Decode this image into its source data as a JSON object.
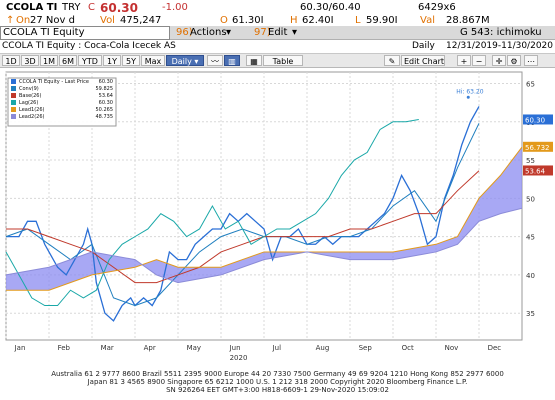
{
  "ticker": {
    "symbol": "CCOLA TI",
    "currency": "TRY",
    "change_flag": "C",
    "last": "60.30",
    "change": "-1.00",
    "bid_ask": "60.30/60.40",
    "size": "6429x6",
    "date_prefix": "On",
    "date": "27 Nov d",
    "vol_label": "Vol",
    "vol": "475,247",
    "open_label": "O",
    "open": "61.30I",
    "high_label": "H",
    "high": "62.40I",
    "low_label": "L",
    "low": "59.90I",
    "val_label": "Val",
    "val": "28.867M"
  },
  "menubar": {
    "actions_num": "96)",
    "actions": "Actions",
    "edit_num": "97)",
    "edit": "Edit",
    "page": "G 543: ichimoku"
  },
  "window": {
    "security": "CCOLA TI Equity",
    "name": "CCOLA TI Equity : Coca-Cola Icecek AS",
    "frequency": "Daily",
    "range": "12/31/2019-11/30/2020"
  },
  "toolbar": {
    "periods": [
      "1D",
      "3D",
      "1M",
      "6M",
      "YTD",
      "1Y",
      "5Y",
      "Max"
    ],
    "freq": "Daily",
    "table": "Table",
    "edit_chart": "Edit Chart"
  },
  "legend": [
    {
      "label": "CCOLA TI Equity - Last Price",
      "value": "60.30",
      "color": "#2a6fd6"
    },
    {
      "label": "Conv(9)",
      "value": "59.825",
      "color": "#1f7fbf"
    },
    {
      "label": "Base(26)",
      "value": "53.64",
      "color": "#c0392b"
    },
    {
      "label": "Lag(26)",
      "value": "60.30",
      "color": "#1aa8a8"
    },
    {
      "label": "Lead1(26)",
      "value": "50.265",
      "color": "#e39a1b"
    },
    {
      "label": "Lead2(26)",
      "value": "48.735",
      "color": "#8b8bd8"
    }
  ],
  "annotation": "Hi: 63.20",
  "price_tags": [
    {
      "value": "60.30",
      "color": "#2a6fd6"
    },
    {
      "value": "56.732",
      "color": "#e39a1b"
    },
    {
      "value": "53.64",
      "color": "#c0392b"
    }
  ],
  "footer": {
    "line1": "Australia 61 2 9777 8600 Brazil 5511 2395 9000 Europe 44 20 7330 7500 Germany 49 69 9204 1210 Hong Kong 852 2977 6000",
    "line2": "Japan 81 3 4565 8900        Singapore 65 6212 1000       U.S. 1 212 318 2000        Copyright 2020 Bloomberg Finance L.P.",
    "line3": "SN 926264 EET  GMT+3:00 H818-6609-1 29-Nov-2020 15:09:02"
  },
  "chart_data": {
    "type": "line",
    "x_labels": [
      "Jan",
      "Feb",
      "Mar",
      "Apr",
      "May",
      "Jun",
      "Jul",
      "Aug",
      "Sep",
      "Oct",
      "Nov",
      "Dec"
    ],
    "year_label": "2020",
    "y_ticks": [
      35,
      40,
      45,
      50,
      55,
      60,
      65
    ],
    "ylim": [
      31.5,
      66.5
    ],
    "grid": true,
    "legend_placement": "top-left",
    "series": [
      {
        "name": "CCOLA TI Equity - Last Price",
        "color": "#2a6fd6",
        "x": [
          0.0,
          0.3,
          0.5,
          0.7,
          0.9,
          1.0,
          1.2,
          1.4,
          1.6,
          1.8,
          1.9,
          2.0,
          2.1,
          2.3,
          2.5,
          2.7,
          2.9,
          3.0,
          3.2,
          3.4,
          3.6,
          3.8,
          4.0,
          4.2,
          4.4,
          4.6,
          4.8,
          5.0,
          5.2,
          5.4,
          5.6,
          5.8,
          6.0,
          6.2,
          6.4,
          6.6,
          6.8,
          7.0,
          7.2,
          7.4,
          7.6,
          7.8,
          8.0,
          8.2,
          8.4,
          8.6,
          8.8,
          9.0,
          9.2,
          9.4,
          9.6,
          9.8,
          10.0,
          10.2,
          10.4,
          10.6,
          10.8,
          11.0
        ],
        "y": [
          45,
          45,
          47,
          47,
          44,
          43,
          41,
          40,
          42,
          44,
          46,
          44,
          39,
          35,
          34,
          36,
          37,
          36,
          37,
          36,
          38,
          43,
          42,
          42,
          44,
          45,
          46,
          46,
          48,
          47,
          48,
          47,
          46,
          42,
          45,
          45,
          46,
          44,
          44,
          45,
          44,
          45,
          45,
          45,
          46,
          47,
          48,
          50,
          53,
          51,
          48,
          44,
          45,
          50,
          53,
          57,
          60,
          62
        ]
      },
      {
        "name": "Conv(9)",
        "color": "#1f7fbf",
        "x": [
          0.0,
          0.5,
          1.0,
          1.5,
          2.0,
          2.5,
          3.0,
          3.5,
          4.0,
          4.5,
          5.0,
          5.5,
          6.0,
          6.5,
          7.0,
          7.5,
          8.0,
          8.5,
          9.0,
          9.5,
          10.0,
          10.5,
          11.0
        ],
        "y": [
          45,
          46,
          44,
          42,
          44,
          37,
          36,
          37,
          40,
          43,
          45,
          46,
          45,
          45,
          44,
          45,
          45,
          46,
          49,
          51,
          47,
          54,
          59.8
        ]
      },
      {
        "name": "Base(26)",
        "color": "#c0392b",
        "x": [
          0.0,
          0.5,
          1.0,
          1.5,
          2.0,
          2.5,
          3.0,
          3.5,
          4.0,
          4.5,
          5.0,
          5.5,
          6.0,
          6.5,
          7.0,
          7.5,
          8.0,
          8.5,
          9.0,
          9.5,
          10.0,
          10.5,
          11.0
        ],
        "y": [
          46,
          46,
          45,
          44,
          43,
          41,
          39,
          39,
          40,
          41,
          43,
          44,
          45,
          45,
          45,
          45,
          46,
          46,
          47,
          48,
          48,
          51,
          53.6
        ]
      },
      {
        "name": "Lag(26)",
        "color": "#1aa8a8",
        "x": [
          0.0,
          0.3,
          0.6,
          0.9,
          1.2,
          1.5,
          1.8,
          2.1,
          2.4,
          2.7,
          3.0,
          3.3,
          3.6,
          3.9,
          4.2,
          4.5,
          4.8,
          5.1,
          5.4,
          5.7,
          6.0,
          6.3,
          6.6,
          6.9,
          7.2,
          7.5,
          7.8,
          8.1,
          8.4,
          8.7,
          9.0,
          9.3,
          9.6
        ],
        "y": [
          43,
          40,
          37,
          36,
          36,
          38,
          37,
          38,
          42,
          44,
          45,
          46,
          48,
          47,
          45,
          46,
          49,
          46,
          47,
          44,
          45,
          46,
          46,
          47,
          48,
          50,
          53,
          55,
          56,
          59,
          60,
          60,
          60.3
        ]
      },
      {
        "name": "Lead1(26)",
        "color": "#e39a1b",
        "x": [
          0.0,
          1.0,
          2.0,
          3.0,
          3.5,
          4.0,
          5.0,
          6.0,
          7.0,
          8.0,
          9.0,
          10.0,
          10.5,
          11.0,
          11.5,
          12.0
        ],
        "y": [
          38,
          38,
          40,
          41,
          42,
          41,
          41,
          43,
          43,
          43,
          43,
          44,
          45,
          50,
          53,
          56.7
        ]
      },
      {
        "name": "Lead2(26)",
        "color": "#8b8bd8",
        "x": [
          0.0,
          1.0,
          2.0,
          3.0,
          3.5,
          4.0,
          5.0,
          6.0,
          7.0,
          8.0,
          9.0,
          10.0,
          10.5,
          11.0,
          11.5,
          12.0
        ],
        "y": [
          40,
          41,
          43,
          42,
          40,
          39,
          40,
          42,
          43,
          42,
          42,
          43,
          44,
          47,
          48,
          48.7
        ]
      }
    ]
  }
}
